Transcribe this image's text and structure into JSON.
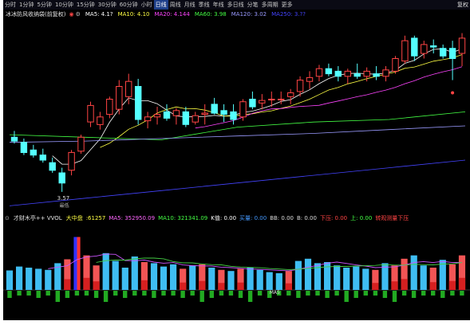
{
  "toolbar": {
    "periods": [
      "分时",
      "1分钟",
      "5分钟",
      "10分钟",
      "15分钟",
      "30分钟",
      "60分钟",
      "小时",
      "日线",
      "周线",
      "月线",
      "季线",
      "年线",
      "多日线",
      "分笔",
      "多周期",
      "更多"
    ],
    "active_period": "日线",
    "right_label": "复权"
  },
  "ma_row": {
    "title": "冰冰防风收纳袋(前复权)",
    "items": [
      {
        "label": "MA5: 4.1?",
        "color": "#ffffff"
      },
      {
        "label": "MA10: 4.10",
        "color": "#ffff44"
      },
      {
        "label": "MA20: 4.144",
        "color": "#ff44ff"
      },
      {
        "label": "MA60: 3.98",
        "color": "#44ff44"
      },
      {
        "label": "MA120: 3.02",
        "color": "#9a9aff"
      },
      {
        "label": "MA250: 3.??",
        "color": "#4444ff"
      }
    ]
  },
  "price_panel": {
    "low_label": "3.57",
    "low_marker": "最低",
    "ohlc": [
      [
        4.0,
        4.05,
        3.95,
        3.97
      ],
      [
        3.96,
        3.99,
        3.86,
        3.88
      ],
      [
        3.9,
        3.94,
        3.84,
        3.86
      ],
      [
        3.86,
        3.91,
        3.8,
        3.82
      ],
      [
        3.8,
        3.84,
        3.72,
        3.74
      ],
      [
        3.72,
        3.76,
        3.57,
        3.64
      ],
      [
        3.74,
        3.9,
        3.7,
        3.88
      ],
      [
        3.89,
        4.02,
        3.87,
        4.0
      ],
      [
        4.12,
        4.28,
        4.08,
        4.25
      ],
      [
        4.1,
        4.2,
        4.06,
        4.16
      ],
      [
        4.18,
        4.32,
        4.15,
        4.3
      ],
      [
        4.22,
        4.45,
        4.18,
        4.4
      ],
      [
        4.32,
        4.5,
        4.26,
        4.44
      ],
      [
        4.4,
        4.46,
        4.1,
        4.14
      ],
      [
        4.13,
        4.2,
        4.07,
        4.16
      ],
      [
        4.16,
        4.24,
        4.1,
        4.18
      ],
      [
        4.2,
        4.26,
        4.13,
        4.15
      ],
      [
        4.17,
        4.23,
        4.1,
        4.21
      ],
      [
        4.2,
        4.24,
        4.08,
        4.1
      ],
      [
        4.12,
        4.2,
        4.1,
        4.17
      ],
      [
        4.18,
        4.26,
        4.1,
        4.19
      ],
      [
        4.26,
        4.31,
        4.18,
        4.19
      ],
      [
        4.21,
        4.26,
        4.12,
        4.18
      ],
      [
        4.2,
        4.26,
        4.1,
        4.14
      ],
      [
        4.16,
        4.3,
        4.13,
        4.28
      ],
      [
        4.3,
        4.36,
        4.22,
        4.24
      ],
      [
        4.27,
        4.34,
        4.22,
        4.29
      ],
      [
        4.3,
        4.36,
        4.24,
        4.3
      ],
      [
        4.3,
        4.36,
        4.26,
        4.3
      ],
      [
        4.32,
        4.38,
        4.26,
        4.35
      ],
      [
        4.36,
        4.48,
        4.32,
        4.45
      ],
      [
        4.44,
        4.52,
        4.38,
        4.47
      ],
      [
        4.48,
        4.57,
        4.44,
        4.54
      ],
      [
        4.54,
        4.58,
        4.48,
        4.5
      ],
      [
        4.52,
        4.56,
        4.44,
        4.48
      ],
      [
        4.48,
        4.54,
        4.42,
        4.52
      ],
      [
        4.5,
        4.58,
        4.46,
        4.48
      ],
      [
        4.48,
        4.55,
        4.44,
        4.52
      ],
      [
        4.5,
        4.56,
        4.45,
        4.48
      ],
      [
        4.48,
        4.56,
        4.44,
        4.53
      ],
      [
        4.52,
        4.64,
        4.5,
        4.62
      ],
      [
        4.6,
        4.8,
        4.58,
        4.76
      ],
      [
        4.78,
        4.8,
        4.6,
        4.64
      ],
      [
        4.66,
        4.76,
        4.62,
        4.73
      ],
      [
        4.72,
        4.77,
        4.66,
        4.71
      ],
      [
        4.7,
        4.73,
        4.62,
        4.64
      ],
      [
        4.7,
        4.76,
        4.45,
        4.62
      ],
      [
        4.66,
        4.82,
        4.56,
        4.78
      ]
    ],
    "price_range": [
      3.45,
      4.88
    ]
  },
  "indicator_row": {
    "title": "才财木亭++ VVOL",
    "items": [
      {
        "label": "大中盘",
        "color": "#ffff44"
      },
      {
        "label": ":61257",
        "color": "#ffff44"
      },
      {
        "label": "MA5: 352950.09",
        "color": "#ff66ff"
      },
      {
        "label": "MA10: 321341.09",
        "color": "#44ff44"
      },
      {
        "label": "K值: 0.00",
        "color": "#ffffff"
      },
      {
        "label": "买量: 0.00",
        "color": "#4499ff"
      },
      {
        "label": "BB: 0.00",
        "color": "#dddddd"
      },
      {
        "label": "B: 0.00",
        "color": "#dddddd"
      },
      {
        "label": "下压: 0.00",
        "color": "#ff4444"
      },
      {
        "label": "上: 0.00",
        "color": "#44ff44"
      },
      {
        "label": "转观测量下压",
        "color": "#ff4444"
      }
    ]
  },
  "indicator_panel": {
    "volume_bars": [
      {
        "v": 0.35,
        "up": false
      },
      {
        "v": 0.42,
        "up": false
      },
      {
        "v": 0.4,
        "up": false
      },
      {
        "v": 0.38,
        "up": false
      },
      {
        "v": 0.36,
        "up": false
      },
      {
        "v": 0.48,
        "up": false
      },
      {
        "v": 0.55,
        "up": true
      },
      {
        "v": 0.95,
        "up": true
      },
      {
        "v": 0.62,
        "up": true
      },
      {
        "v": 0.44,
        "up": true
      },
      {
        "v": 0.66,
        "up": false
      },
      {
        "v": 0.52,
        "up": false
      },
      {
        "v": 0.4,
        "up": false
      },
      {
        "v": 0.6,
        "up": false
      },
      {
        "v": 0.5,
        "up": true
      },
      {
        "v": 0.48,
        "up": false
      },
      {
        "v": 0.42,
        "up": false
      },
      {
        "v": 0.46,
        "up": false
      },
      {
        "v": 0.38,
        "up": true
      },
      {
        "v": 0.44,
        "up": false
      },
      {
        "v": 0.46,
        "up": true
      },
      {
        "v": 0.4,
        "up": false
      },
      {
        "v": 0.36,
        "up": true
      },
      {
        "v": 0.34,
        "up": false
      },
      {
        "v": 0.38,
        "up": true
      },
      {
        "v": 0.4,
        "up": false
      },
      {
        "v": 0.36,
        "up": false
      },
      {
        "v": 0.32,
        "up": false
      },
      {
        "v": 0.3,
        "up": false
      },
      {
        "v": 0.34,
        "up": true
      },
      {
        "v": 0.52,
        "up": false
      },
      {
        "v": 0.56,
        "up": false
      },
      {
        "v": 0.48,
        "up": false
      },
      {
        "v": 0.5,
        "up": false
      },
      {
        "v": 0.44,
        "up": false
      },
      {
        "v": 0.4,
        "up": false
      },
      {
        "v": 0.42,
        "up": false
      },
      {
        "v": 0.38,
        "up": false
      },
      {
        "v": 0.36,
        "up": true
      },
      {
        "v": 0.48,
        "up": false
      },
      {
        "v": 0.44,
        "up": true
      },
      {
        "v": 0.56,
        "up": true
      },
      {
        "v": 0.62,
        "up": false
      },
      {
        "v": 0.44,
        "up": false
      },
      {
        "v": 0.4,
        "up": true
      },
      {
        "v": 0.54,
        "up": false
      },
      {
        "v": 0.46,
        "up": true
      },
      {
        "v": 0.62,
        "up": true
      }
    ],
    "highlight_index": 7,
    "mid_label": "MA5"
  }
}
